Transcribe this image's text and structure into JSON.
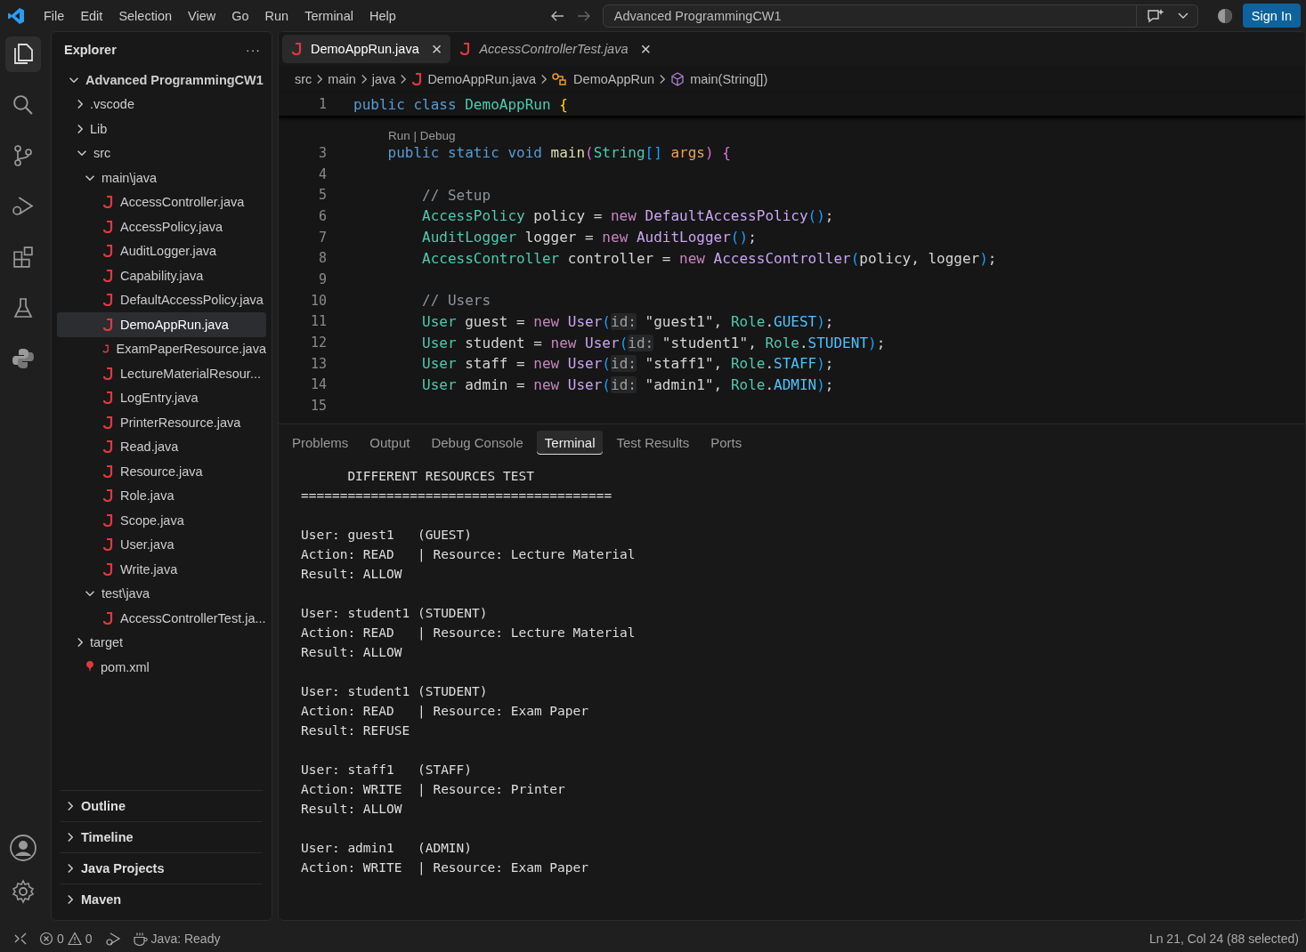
{
  "menu": [
    "File",
    "Edit",
    "Selection",
    "View",
    "Go",
    "Run",
    "Terminal",
    "Help"
  ],
  "command_center": {
    "value": "Advanced ProgrammingCW1"
  },
  "sign_in": "Sign In",
  "activity_bar": [
    {
      "kind": "files",
      "selected": true
    },
    {
      "kind": "search",
      "selected": false
    },
    {
      "kind": "branch",
      "selected": false
    },
    {
      "kind": "debug",
      "selected": false
    },
    {
      "kind": "blocks",
      "selected": false
    },
    {
      "kind": "flask",
      "selected": false
    },
    {
      "kind": "snake",
      "selected": false
    }
  ],
  "sidebar": {
    "title": "Explorer",
    "more": "···",
    "tree": [
      {
        "label": "Advanced ProgrammingCW1",
        "kind": "root",
        "expanded": true,
        "selected": false,
        "children": [
          {
            "label": ".vscode",
            "kind": "folder",
            "expanded": false,
            "selected": false
          },
          {
            "label": "Lib",
            "kind": "folder",
            "expanded": false,
            "selected": false
          },
          {
            "label": "src",
            "kind": "folder",
            "expanded": true,
            "selected": false,
            "children": [
              {
                "label": "main\\java",
                "kind": "folder",
                "expanded": true,
                "selected": false,
                "children": [
                  {
                    "label": "AccessController.java",
                    "kind": "java",
                    "selected": false
                  },
                  {
                    "label": "AccessPolicy.java",
                    "kind": "java",
                    "selected": false
                  },
                  {
                    "label": "AuditLogger.java",
                    "kind": "java",
                    "selected": false
                  },
                  {
                    "label": "Capability.java",
                    "kind": "java",
                    "selected": false
                  },
                  {
                    "label": "DefaultAccessPolicy.java",
                    "kind": "java",
                    "selected": false
                  },
                  {
                    "label": "DemoAppRun.java",
                    "kind": "java",
                    "selected": true
                  },
                  {
                    "label": "ExamPaperResource.java",
                    "kind": "java",
                    "selected": false
                  },
                  {
                    "label": "LectureMaterialResour...",
                    "kind": "java",
                    "selected": false
                  },
                  {
                    "label": "LogEntry.java",
                    "kind": "java",
                    "selected": false
                  },
                  {
                    "label": "PrinterResource.java",
                    "kind": "java",
                    "selected": false
                  },
                  {
                    "label": "Read.java",
                    "kind": "java",
                    "selected": false
                  },
                  {
                    "label": "Resource.java",
                    "kind": "java",
                    "selected": false
                  },
                  {
                    "label": "Role.java",
                    "kind": "java",
                    "selected": false
                  },
                  {
                    "label": "Scope.java",
                    "kind": "java",
                    "selected": false
                  },
                  {
                    "label": "User.java",
                    "kind": "java",
                    "selected": false
                  },
                  {
                    "label": "Write.java",
                    "kind": "java",
                    "selected": false
                  }
                ]
              },
              {
                "label": "test\\java",
                "kind": "folder",
                "expanded": true,
                "selected": false,
                "children": [
                  {
                    "label": "AccessControllerTest.ja...",
                    "kind": "java",
                    "selected": false
                  }
                ]
              }
            ]
          },
          {
            "label": "target",
            "kind": "folder",
            "expanded": false,
            "selected": false
          },
          {
            "label": "pom.xml",
            "kind": "xml",
            "selected": false
          }
        ]
      }
    ],
    "sections": [
      {
        "label": "Outline",
        "expanded": false
      },
      {
        "label": "Timeline",
        "expanded": false
      },
      {
        "label": "Java Projects",
        "expanded": false
      },
      {
        "label": "Maven",
        "expanded": false
      }
    ]
  },
  "editor_tabs": [
    {
      "label": "DemoAppRun.java",
      "selected": true,
      "preview": false,
      "close": "×"
    },
    {
      "label": "AccessControllerTest.java",
      "selected": false,
      "preview": true,
      "close": "×"
    }
  ],
  "breadcrumbs": [
    {
      "label": "src",
      "kind": "folder"
    },
    {
      "label": "main",
      "kind": "folder"
    },
    {
      "label": "java",
      "kind": "folder"
    },
    {
      "label": "DemoAppRun.java",
      "kind": "java"
    },
    {
      "label": "DemoAppRun",
      "kind": "class"
    },
    {
      "label": "main(String[])",
      "kind": "method"
    }
  ],
  "sticky_line": {
    "number": "1",
    "tokens": [
      {
        "text": "public class ",
        "kind": "kw"
      },
      {
        "text": "DemoAppRun ",
        "kind": "type"
      },
      {
        "text": "{",
        "kind": "br1"
      }
    ]
  },
  "codelens": "Run | Debug",
  "code_lines": [
    {
      "number": "3",
      "tokens": [
        {
          "text": "    public static void ",
          "kind": "kw"
        },
        {
          "text": "main",
          "kind": "fn"
        },
        {
          "text": "(",
          "kind": "br2"
        },
        {
          "text": "String",
          "kind": "type"
        },
        {
          "text": "[] ",
          "kind": "br3"
        },
        {
          "text": "args",
          "kind": "param"
        },
        {
          "text": ") {",
          "kind": "br2"
        }
      ]
    },
    {
      "number": "4"
    },
    {
      "number": "5",
      "tokens": [
        {
          "text": "        // Setup",
          "kind": "comment"
        }
      ]
    },
    {
      "number": "6",
      "tokens": [
        {
          "text": "        AccessPolicy",
          "kind": "type"
        },
        {
          "text": " policy = ",
          "kind": "plain"
        },
        {
          "text": "new ",
          "kind": "new"
        },
        {
          "text": "DefaultAccessPolicy",
          "kind": "cls"
        },
        {
          "text": "()",
          "kind": "br3"
        },
        {
          "text": ";",
          "kind": "plain"
        }
      ]
    },
    {
      "number": "7",
      "tokens": [
        {
          "text": "        AuditLogger",
          "kind": "type"
        },
        {
          "text": " logger = ",
          "kind": "plain"
        },
        {
          "text": "new ",
          "kind": "new"
        },
        {
          "text": "AuditLogger",
          "kind": "cls"
        },
        {
          "text": "()",
          "kind": "br3"
        },
        {
          "text": ";",
          "kind": "plain"
        }
      ]
    },
    {
      "number": "8",
      "tokens": [
        {
          "text": "        AccessController",
          "kind": "type"
        },
        {
          "text": " controller = ",
          "kind": "plain"
        },
        {
          "text": "new ",
          "kind": "new"
        },
        {
          "text": "AccessController",
          "kind": "cls"
        },
        {
          "text": "(",
          "kind": "br3"
        },
        {
          "text": "policy, logger",
          "kind": "plain"
        },
        {
          "text": ")",
          "kind": "br3"
        },
        {
          "text": ";",
          "kind": "plain"
        }
      ]
    },
    {
      "number": "9"
    },
    {
      "number": "10",
      "tokens": [
        {
          "text": "        // Users",
          "kind": "comment"
        }
      ]
    },
    {
      "number": "11",
      "tokens": [
        {
          "text": "        User",
          "kind": "type"
        },
        {
          "text": " guest = ",
          "kind": "plain"
        },
        {
          "text": "new ",
          "kind": "new"
        },
        {
          "text": "User",
          "kind": "cls"
        },
        {
          "text": "(",
          "kind": "br3"
        },
        {
          "text": "id:",
          "kind": "hint"
        },
        {
          "text": " \"guest1\", ",
          "kind": "plain"
        },
        {
          "text": "Role",
          "kind": "type"
        },
        {
          "text": ".",
          "kind": "plain"
        },
        {
          "text": "GUEST",
          "kind": "const"
        },
        {
          "text": ")",
          "kind": "br3"
        },
        {
          "text": ";",
          "kind": "plain"
        }
      ]
    },
    {
      "number": "12",
      "tokens": [
        {
          "text": "        User",
          "kind": "type"
        },
        {
          "text": " student = ",
          "kind": "plain"
        },
        {
          "text": "new ",
          "kind": "new"
        },
        {
          "text": "User",
          "kind": "cls"
        },
        {
          "text": "(",
          "kind": "br3"
        },
        {
          "text": "id:",
          "kind": "hint"
        },
        {
          "text": " \"student1\", ",
          "kind": "plain"
        },
        {
          "text": "Role",
          "kind": "type"
        },
        {
          "text": ".",
          "kind": "plain"
        },
        {
          "text": "STUDENT",
          "kind": "const"
        },
        {
          "text": ")",
          "kind": "br3"
        },
        {
          "text": ";",
          "kind": "plain"
        }
      ]
    },
    {
      "number": "13",
      "tokens": [
        {
          "text": "        User",
          "kind": "type"
        },
        {
          "text": " staff = ",
          "kind": "plain"
        },
        {
          "text": "new ",
          "kind": "new"
        },
        {
          "text": "User",
          "kind": "cls"
        },
        {
          "text": "(",
          "kind": "br3"
        },
        {
          "text": "id:",
          "kind": "hint"
        },
        {
          "text": " \"staff1\", ",
          "kind": "plain"
        },
        {
          "text": "Role",
          "kind": "type"
        },
        {
          "text": ".",
          "kind": "plain"
        },
        {
          "text": "STAFF",
          "kind": "const"
        },
        {
          "text": ")",
          "kind": "br3"
        },
        {
          "text": ";",
          "kind": "plain"
        }
      ]
    },
    {
      "number": "14",
      "tokens": [
        {
          "text": "        User",
          "kind": "type"
        },
        {
          "text": " admin = ",
          "kind": "plain"
        },
        {
          "text": "new ",
          "kind": "new"
        },
        {
          "text": "User",
          "kind": "cls"
        },
        {
          "text": "(",
          "kind": "br3"
        },
        {
          "text": "id:",
          "kind": "hint"
        },
        {
          "text": " \"admin1\", ",
          "kind": "plain"
        },
        {
          "text": "Role",
          "kind": "type"
        },
        {
          "text": ".",
          "kind": "plain"
        },
        {
          "text": "ADMIN",
          "kind": "const"
        },
        {
          "text": ")",
          "kind": "br3"
        },
        {
          "text": ";",
          "kind": "plain"
        }
      ]
    },
    {
      "number": "15"
    }
  ],
  "panel_tabs": [
    {
      "label": "Problems",
      "selected": false
    },
    {
      "label": "Output",
      "selected": false
    },
    {
      "label": "Debug Console",
      "selected": false
    },
    {
      "label": "Terminal",
      "selected": true
    },
    {
      "label": "Test Results",
      "selected": false
    },
    {
      "label": "Ports",
      "selected": false
    }
  ],
  "terminal": [
    [
      "      DIFFERENT RESOURCES TEST",
      "========================================"
    ],
    [
      "User: guest1   (GUEST)",
      "Action: READ   | Resource: Lecture Material",
      "Result: ALLOW"
    ],
    [
      "User: student1 (STUDENT)",
      "Action: READ   | Resource: Lecture Material",
      "Result: ALLOW"
    ],
    [
      "User: student1 (STUDENT)",
      "Action: READ   | Resource: Exam Paper",
      "Result: REFUSE"
    ],
    [
      "User: staff1   (STAFF)",
      "Action: WRITE  | Resource: Printer",
      "Result: ALLOW"
    ],
    [
      "User: admin1   (ADMIN)",
      "Action: WRITE  | Resource: Exam Paper"
    ]
  ],
  "status_bar": {
    "errors": "0",
    "warnings": "0",
    "java": "Java: Ready",
    "position": "Ln 21, Col 24 (88 selected)"
  }
}
